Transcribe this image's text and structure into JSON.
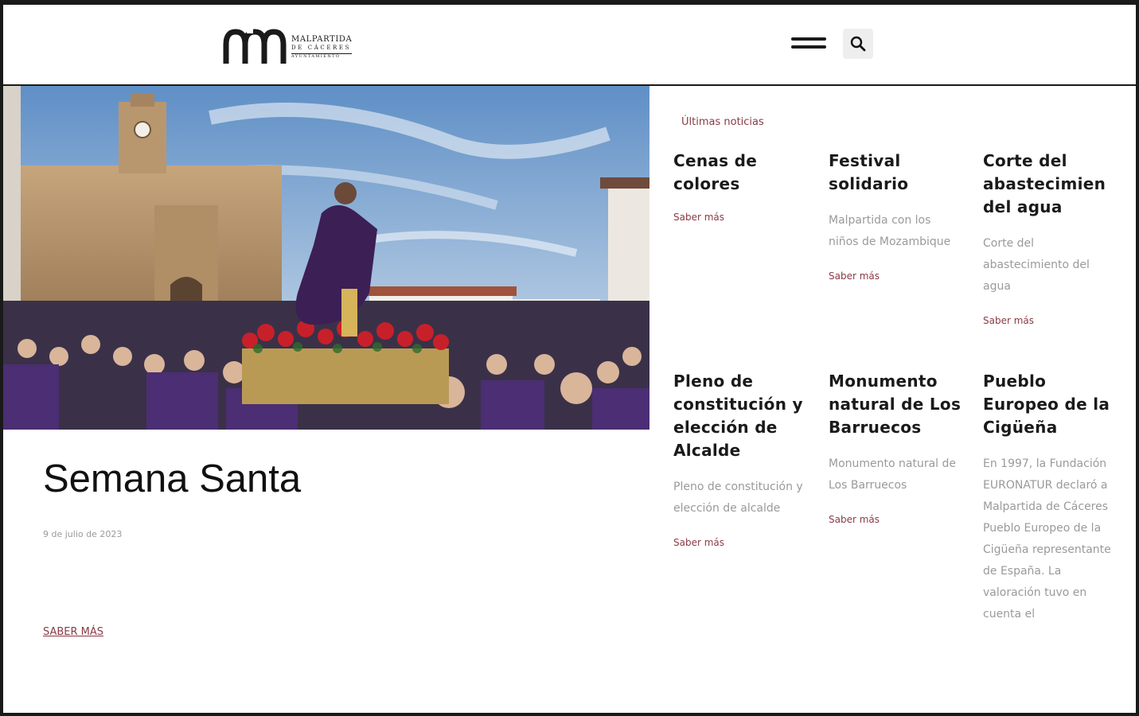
{
  "header": {
    "logo": {
      "line1": "MALPARTIDA",
      "line2": "DE CÁCERES",
      "line3": "AYUNTAMIENTO"
    },
    "menu_icon": "hamburger-menu-icon",
    "search_icon": "search-icon"
  },
  "hero": {
    "image_icon": "procession-photo",
    "title": "Semana Santa",
    "date": "9 de julio de 2023",
    "more_label": "SABER MÁS"
  },
  "news": {
    "heading": "Últimas noticias",
    "items": [
      {
        "title": "Cenas de colores",
        "excerpt": "",
        "more": "Saber más"
      },
      {
        "title": "Festival solidario",
        "excerpt": "Malpartida con los niños de Mozambique",
        "more": "Saber más"
      },
      {
        "title": "Corte del abastecimiento del agua",
        "title_lines": [
          "Corte del",
          "abastecimien",
          "del agua"
        ],
        "excerpt": "Corte del abastecimiento del agua",
        "more": "Saber más"
      },
      {
        "title": "Pleno de constitución y elección de Alcalde",
        "excerpt": "Pleno de constitución y elección de alcalde",
        "more": "Saber más"
      },
      {
        "title": "Monumento natural de Los Barruecos",
        "excerpt": "Monumento natural de Los Barruecos",
        "more": "Saber más"
      },
      {
        "title": "Pueblo Europeo de la Cigüeña",
        "excerpt": "En 1997, la Fundación EURONATUR declaró a Malpartida de Cáceres Pueblo Europeo de la Cigüeña representante de España. La valoración tuvo en cuenta el",
        "more": ""
      }
    ]
  },
  "colors": {
    "accent": "#8a3a44",
    "text": "#1a1a1a",
    "muted": "#9a9a9a",
    "search_bg": "#eeeeee"
  }
}
